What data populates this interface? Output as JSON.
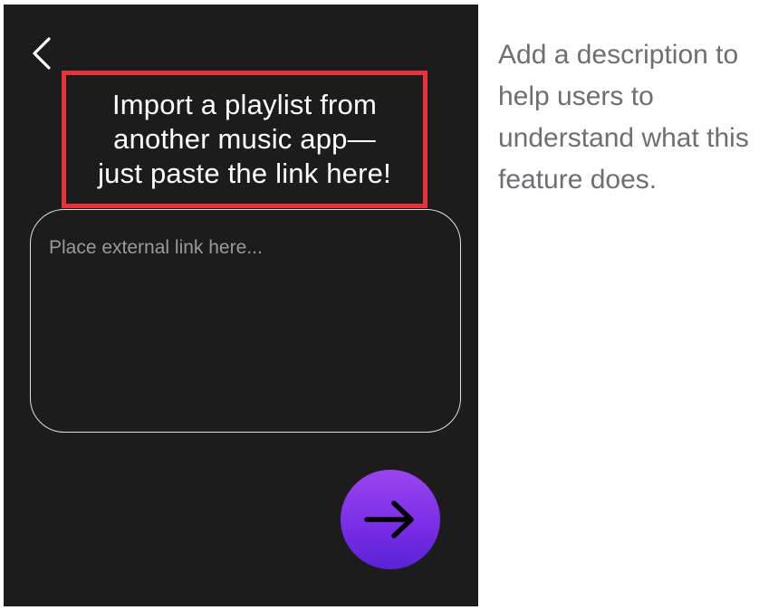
{
  "screen": {
    "back_icon": "chevron-left-icon",
    "headline": "Import a playlist from\nanother music app—\njust paste the link here!",
    "link_input": {
      "placeholder": "Place external link here...",
      "value": ""
    },
    "submit_icon": "arrow-right-icon"
  },
  "annotation": {
    "text": "Add a description to help users to understand what this feature does."
  },
  "colors": {
    "screen_background": "#1c1c1c",
    "highlight_border": "#e8333a",
    "submit_gradient_top": "#9b45f0",
    "submit_gradient_bottom": "#5a22d6",
    "annotation_text": "#6e6e73"
  }
}
